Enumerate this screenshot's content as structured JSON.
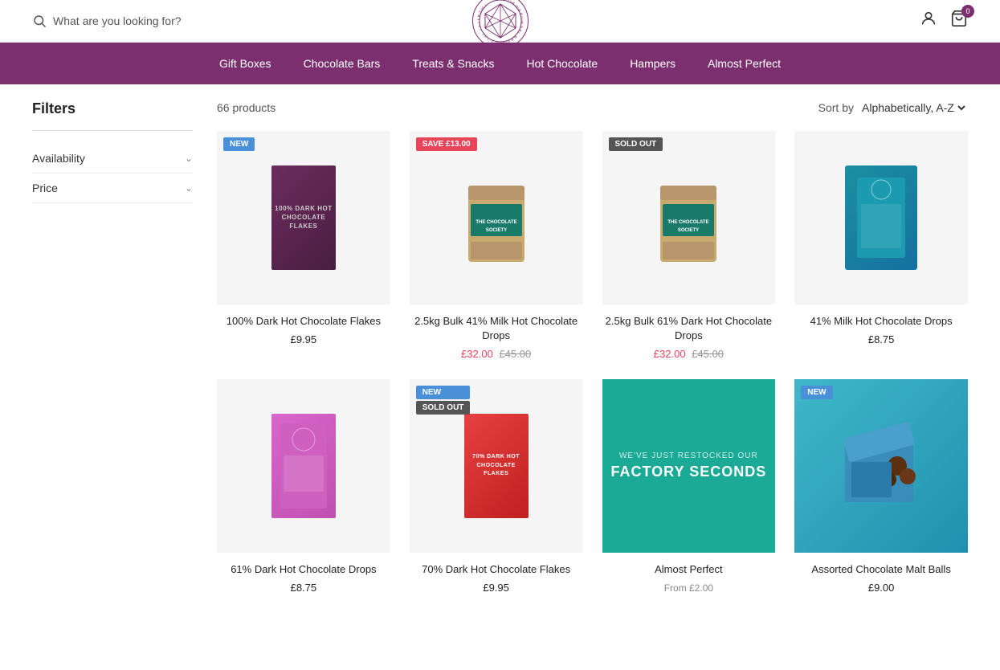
{
  "header": {
    "search_placeholder": "What are you looking for?",
    "cart_count": "0",
    "logo_text": "THE CHOCOLATE SOCIETY"
  },
  "nav": {
    "items": [
      {
        "label": "Gift Boxes",
        "id": "gift-boxes"
      },
      {
        "label": "Chocolate Bars",
        "id": "chocolate-bars"
      },
      {
        "label": "Treats & Snacks",
        "id": "treats-snacks"
      },
      {
        "label": "Hot Chocolate",
        "id": "hot-chocolate"
      },
      {
        "label": "Hampers",
        "id": "hampers"
      },
      {
        "label": "Almost Perfect",
        "id": "almost-perfect"
      }
    ]
  },
  "filters": {
    "title": "Filters",
    "items": [
      {
        "label": "Availability",
        "id": "availability"
      },
      {
        "label": "Price",
        "id": "price"
      }
    ]
  },
  "products_header": {
    "count": "66 products",
    "sort_label": "Sort by",
    "sort_value": "Alphabetically, A-Z"
  },
  "products": [
    {
      "id": "prod1",
      "title": "100% Dark Hot Chocolate Flakes",
      "price": "£9.95",
      "badge": "NEW",
      "badge_type": "new",
      "image_type": "dark-box",
      "image_text": "100% DARK HOT CHOCOLATE FLAKES"
    },
    {
      "id": "prod2",
      "title": "2.5kg Bulk 41% Milk Hot Chocolate Drops",
      "price_sale": "£32.00",
      "price_original": "£45.00",
      "badge": "SAVE £13.00",
      "badge_type": "save",
      "image_type": "bag-green"
    },
    {
      "id": "prod3",
      "title": "2.5kg Bulk 61% Dark Hot Chocolate Drops",
      "price_sale": "£32.00",
      "price_original": "£45.00",
      "badge": "SOLD OUT",
      "badge_type": "sold-out",
      "image_type": "bag-green"
    },
    {
      "id": "prod4",
      "title": "41% Milk Hot Chocolate Drops",
      "price": "£8.75",
      "badge": null,
      "image_type": "teal-box"
    },
    {
      "id": "prod5",
      "title": "61% Dark Hot Chocolate Drops",
      "price": "£8.75",
      "badge": null,
      "image_type": "pink-box"
    },
    {
      "id": "prod6",
      "title": "70% Dark Hot Chocolate Flakes",
      "price": "£9.95",
      "badge": "NEW",
      "badge_type": "new",
      "badge2": "SOLD OUT",
      "badge2_type": "sold-out",
      "image_type": "red-box",
      "image_text": "70% DARK HOT CHOCOLATE FLAKES"
    },
    {
      "id": "prod7",
      "title": "Almost Perfect",
      "price_from": "From £2.00",
      "badge": null,
      "image_type": "teal-banner"
    },
    {
      "id": "prod8",
      "title": "Assorted Chocolate Malt Balls",
      "price": "£9.00",
      "badge": "NEW",
      "badge_type": "new",
      "image_type": "assorted"
    }
  ],
  "icons": {
    "search": "🔍",
    "user": "👤",
    "cart": "🛒",
    "chevron_down": "⌄"
  }
}
